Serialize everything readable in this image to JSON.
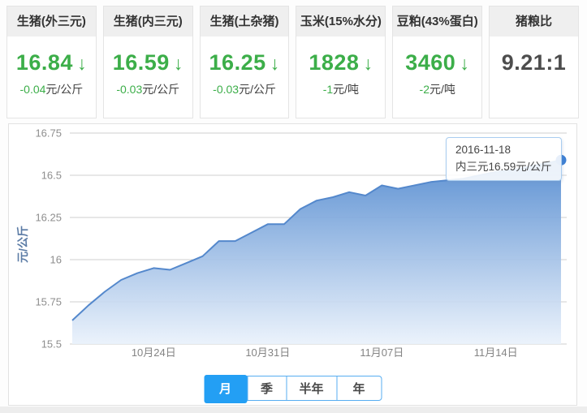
{
  "cards": [
    {
      "title": "生猪(外三元)",
      "value": "16.84",
      "arrow": "↓",
      "delta": "-0.04",
      "delta_unit": "元/公斤"
    },
    {
      "title": "生猪(内三元)",
      "value": "16.59",
      "arrow": "↓",
      "delta": "-0.03",
      "delta_unit": "元/公斤"
    },
    {
      "title": "生猪(土杂猪)",
      "value": "16.25",
      "arrow": "↓",
      "delta": "-0.03",
      "delta_unit": "元/公斤"
    },
    {
      "title": "玉米(15%水分)",
      "value": "1828",
      "arrow": "↓",
      "delta": "-1",
      "delta_unit": "元/吨"
    },
    {
      "title": "豆粕(43%蛋白)",
      "value": "3460",
      "arrow": "↓",
      "delta": "-2",
      "delta_unit": "元/吨"
    },
    {
      "title": "猪粮比",
      "value": "9.21:1",
      "arrow": "",
      "delta": "",
      "delta_unit": ""
    }
  ],
  "chart_tooltip": {
    "date": "2016-11-18",
    "text": "内三元16.59元/公斤"
  },
  "tabs": {
    "active_index": 0,
    "items": [
      {
        "label": "月"
      },
      {
        "label": "季"
      },
      {
        "label": "半年"
      },
      {
        "label": "年"
      }
    ]
  },
  "chart_data": {
    "type": "area",
    "title": "",
    "series_name": "内三元",
    "xlabel": "",
    "ylabel": "元/公斤",
    "ylim": [
      15.5,
      16.75
    ],
    "yticks": [
      15.5,
      15.75,
      16,
      16.25,
      16.5,
      16.75
    ],
    "grid": "horizontal",
    "legend_position": "none",
    "x": [
      "2016-10-19",
      "2016-10-20",
      "2016-10-21",
      "2016-10-22",
      "2016-10-23",
      "2016-10-24",
      "2016-10-25",
      "2016-10-26",
      "2016-10-27",
      "2016-10-28",
      "2016-10-29",
      "2016-10-30",
      "2016-10-31",
      "2016-11-01",
      "2016-11-02",
      "2016-11-03",
      "2016-11-04",
      "2016-11-05",
      "2016-11-06",
      "2016-11-07",
      "2016-11-08",
      "2016-11-09",
      "2016-11-10",
      "2016-11-11",
      "2016-11-12",
      "2016-11-13",
      "2016-11-14",
      "2016-11-15",
      "2016-11-16",
      "2016-11-17",
      "2016-11-18"
    ],
    "values": [
      15.64,
      15.73,
      15.81,
      15.88,
      15.92,
      15.95,
      15.94,
      15.98,
      16.02,
      16.11,
      16.11,
      16.16,
      16.21,
      16.21,
      16.3,
      16.35,
      16.37,
      16.4,
      16.38,
      16.44,
      16.42,
      16.44,
      16.46,
      16.47,
      16.48,
      16.5,
      16.52,
      16.53,
      16.55,
      16.57,
      16.59
    ],
    "xtick_labels": [
      "10月24日",
      "10月31日",
      "11月07日",
      "11月14日"
    ],
    "xtick_indices": [
      5,
      12,
      19,
      26
    ],
    "colors": {
      "line": "#5488cc",
      "area_top": "#548bd0",
      "area_bottom": "#e9f1fb",
      "dot": "#3c7fd4",
      "grid": "#cfcfcf",
      "y_tick_text": "#8e8e8e",
      "x_tick_text": "#848484",
      "axis_name_text": "#5c7ca6",
      "value_green": "#3cae49",
      "active_tab": "#239ff4"
    }
  }
}
